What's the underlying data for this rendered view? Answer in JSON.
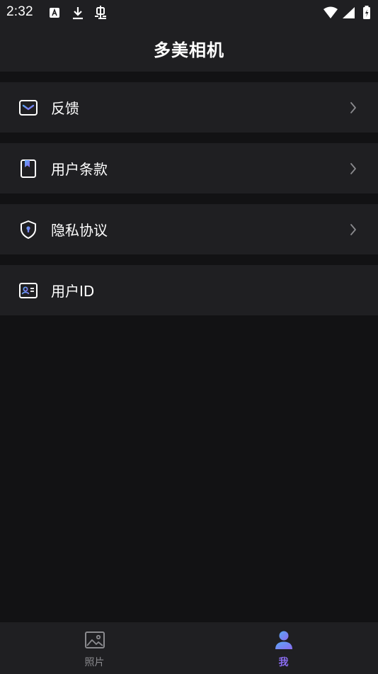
{
  "status_bar": {
    "time": "2:32",
    "icons": [
      "text-a-icon",
      "download-icon",
      "bug-icon",
      "wifi-icon",
      "signal-icon",
      "battery-icon"
    ]
  },
  "header": {
    "title": "多美相机"
  },
  "menu": {
    "items": [
      {
        "label": "反馈",
        "icon": "mail-icon",
        "has_chevron": true
      },
      {
        "label": "用户条款",
        "icon": "bookmark-icon",
        "has_chevron": true
      },
      {
        "label": "隐私协议",
        "icon": "shield-icon",
        "has_chevron": true
      },
      {
        "label": "用户ID",
        "icon": "id-card-icon",
        "has_chevron": false
      }
    ]
  },
  "bottom_nav": {
    "tabs": [
      {
        "label": "照片",
        "icon": "image-icon",
        "active": false
      },
      {
        "label": "我",
        "icon": "user-icon",
        "active": true
      }
    ]
  },
  "colors": {
    "background": "#121214",
    "surface": "#1f1f22",
    "accent_purple": "#8a6cf0",
    "accent_blue": "#5aa8f5",
    "inactive": "#8a8a8e"
  }
}
